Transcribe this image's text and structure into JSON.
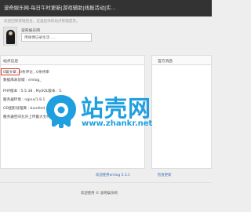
{
  "header": {
    "site_title": "波奇娱乐网-每日午时更新|游戏辅助|线报活动|实..."
  },
  "welcome_text": "欢迎回到管理后台，这里是你的站点管理首页。",
  "user": {
    "name": "波奇娱乐网",
    "note_text": "用微博记录生活......"
  },
  "site_info": {
    "heading": "站点信息",
    "stats_text": "0篇文章 , 0条评论 , 0条待审",
    "db_prefix": "数据库表前缀 : emlog_",
    "php_version": "PHP版本 : 5.5.38 , MySQL版本 : 5.",
    "server_env": "服务器环境 : nginx/1.8.1",
    "gd_lib": "GD图形处理库 : bundled (2.1.0 co",
    "upload_limit": "服务器空间允许上传最大文件 : 50M"
  },
  "official": {
    "heading": "官方消息"
  },
  "watermark": {
    "name": "站壳网",
    "url": "www.zhankr.net",
    "trademark": "®"
  },
  "footer": {
    "welcome": "欢迎使用emlog 5.3.1",
    "update_link": "检查更新"
  },
  "bottom": {
    "copyright": "欢迎使用 © 波奇娱乐网"
  },
  "colors": {
    "topbar": "#333333",
    "highlight": "#e03a2e",
    "brand": "#1f9fe0",
    "link": "#3a6db5"
  }
}
